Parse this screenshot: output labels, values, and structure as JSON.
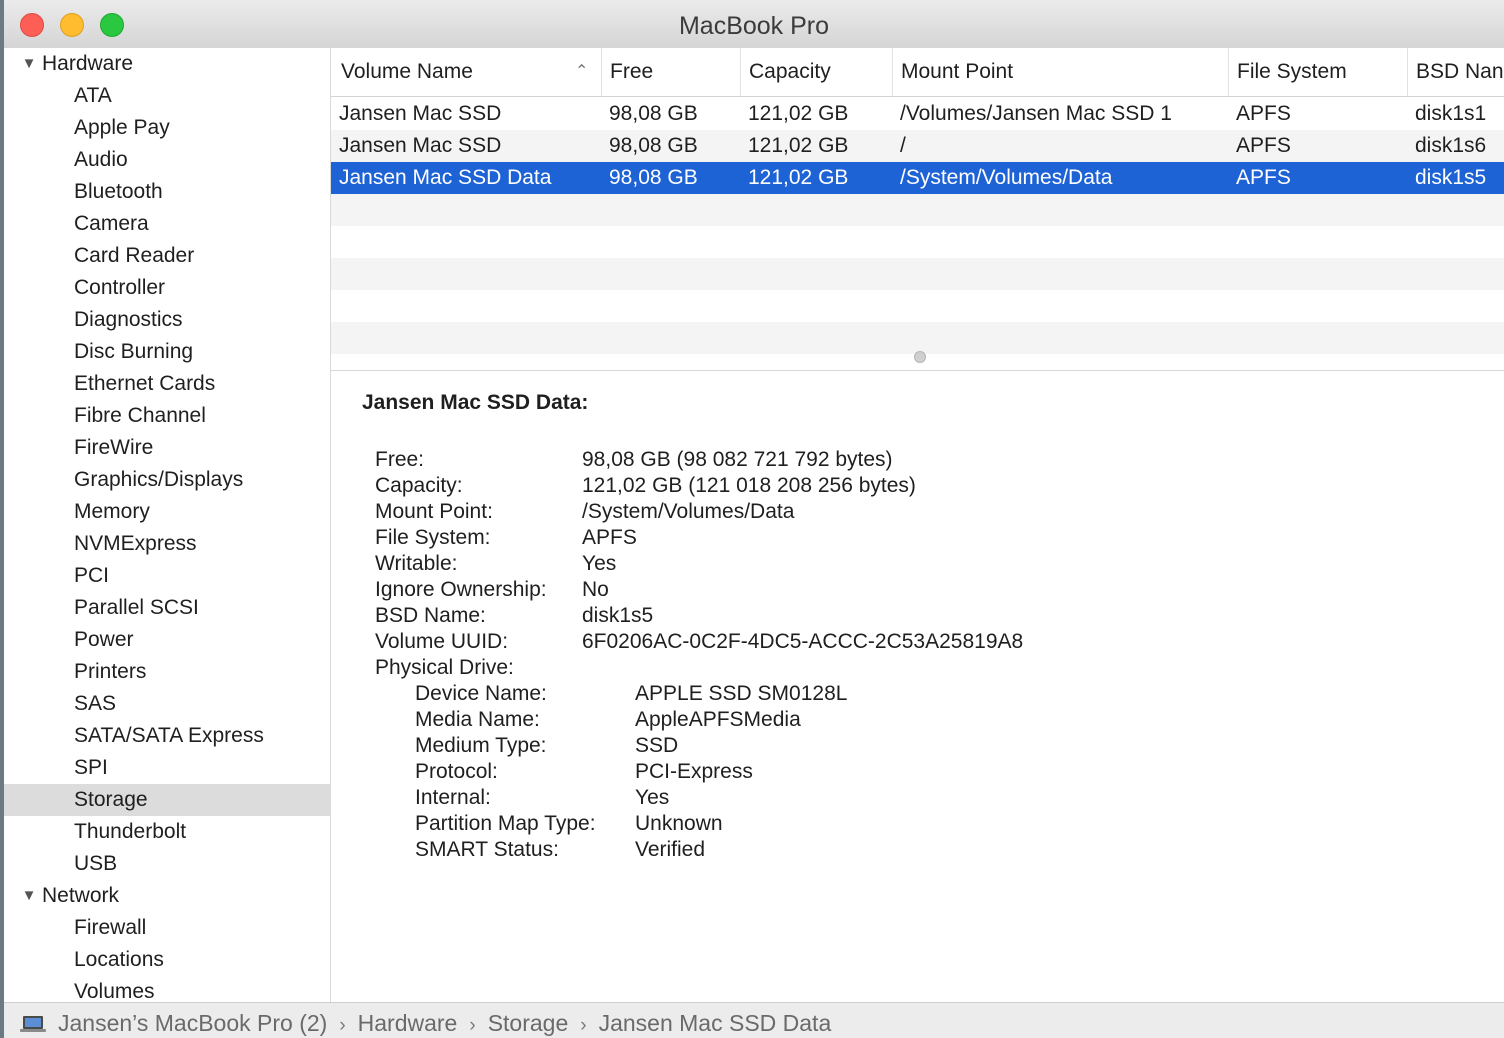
{
  "window": {
    "title": "MacBook Pro"
  },
  "sidebar": {
    "groups": [
      {
        "label": "Hardware",
        "items": [
          "ATA",
          "Apple Pay",
          "Audio",
          "Bluetooth",
          "Camera",
          "Card Reader",
          "Controller",
          "Diagnostics",
          "Disc Burning",
          "Ethernet Cards",
          "Fibre Channel",
          "FireWire",
          "Graphics/Displays",
          "Memory",
          "NVMExpress",
          "PCI",
          "Parallel SCSI",
          "Power",
          "Printers",
          "SAS",
          "SATA/SATA Express",
          "SPI",
          "Storage",
          "Thunderbolt",
          "USB"
        ]
      },
      {
        "label": "Network",
        "items": [
          "Firewall",
          "Locations",
          "Volumes"
        ]
      }
    ],
    "selected": "Storage"
  },
  "table": {
    "columns": [
      "Volume Name",
      "Free",
      "Capacity",
      "Mount Point",
      "File System",
      "BSD Nan"
    ],
    "sort_column": "Volume Name",
    "rows": [
      [
        "Jansen Mac SSD",
        "98,08 GB",
        "121,02 GB",
        "/Volumes/Jansen Mac SSD 1",
        "APFS",
        "disk1s1"
      ],
      [
        "Jansen Mac SSD",
        "98,08 GB",
        "121,02 GB",
        "/",
        "APFS",
        "disk1s6"
      ],
      [
        "Jansen Mac SSD Data",
        "98,08 GB",
        "121,02 GB",
        "/System/Volumes/Data",
        "APFS",
        "disk1s5"
      ]
    ],
    "selected_row": 2
  },
  "detail": {
    "title": "Jansen Mac SSD Data:",
    "fields": [
      {
        "key": "Free:",
        "value": "98,08 GB (98 082 721 792 bytes)"
      },
      {
        "key": "Capacity:",
        "value": "121,02 GB (121 018 208 256 bytes)"
      },
      {
        "key": "Mount Point:",
        "value": "/System/Volumes/Data"
      },
      {
        "key": "File System:",
        "value": "APFS"
      },
      {
        "key": "Writable:",
        "value": "Yes"
      },
      {
        "key": "Ignore Ownership:",
        "value": "No"
      },
      {
        "key": "BSD Name:",
        "value": "disk1s5"
      },
      {
        "key": "Volume UUID:",
        "value": "6F0206AC-0C2F-4DC5-ACCC-2C53A25819A8"
      },
      {
        "key": "Physical Drive:",
        "value": ""
      }
    ],
    "physical_drive": [
      {
        "key": "Device Name:",
        "value": "APPLE SSD SM0128L"
      },
      {
        "key": "Media Name:",
        "value": "AppleAPFSMedia"
      },
      {
        "key": "Medium Type:",
        "value": "SSD"
      },
      {
        "key": "Protocol:",
        "value": "PCI-Express"
      },
      {
        "key": "Internal:",
        "value": "Yes"
      },
      {
        "key": "Partition Map Type:",
        "value": "Unknown"
      },
      {
        "key": "SMART Status:",
        "value": "Verified"
      }
    ]
  },
  "statusbar": {
    "icon": "laptop-icon",
    "breadcrumbs": [
      "Jansen’s MacBook Pro (2)",
      "Hardware",
      "Storage",
      "Jansen Mac SSD Data"
    ],
    "separator": "›"
  },
  "colors": {
    "selection": "#1e63d6",
    "sidebar_selection": "#dcdcdc",
    "close": "#fd5f57",
    "minimize": "#febc2e",
    "zoom": "#29c840"
  }
}
